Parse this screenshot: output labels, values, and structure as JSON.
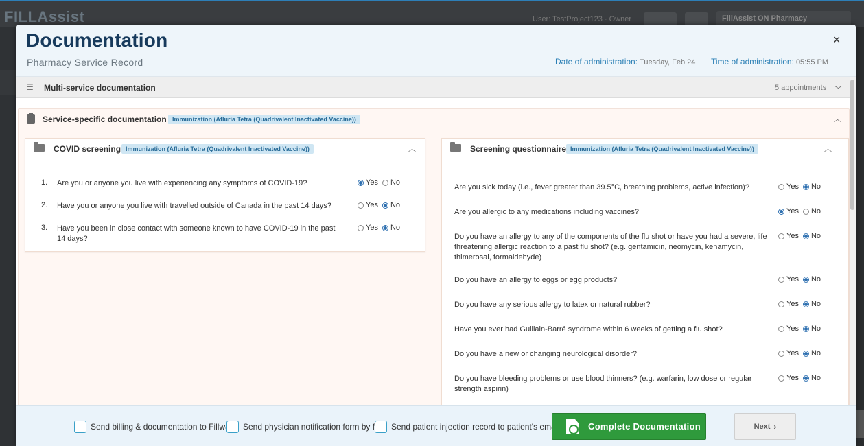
{
  "app": {
    "logo": "FILLAssist",
    "user_text": "User: TestProject123 · Owner",
    "pharmacy": "FillAssist ON Pharmacy"
  },
  "modal": {
    "title": "Documentation",
    "subtitle": "Pharmacy Service Record",
    "close_glyph": "×",
    "date_label": "Date of administration:",
    "date_value": "Tuesday, Feb 24",
    "time_label": "Time of administration:",
    "time_value": "05:55 PM"
  },
  "multi_service": {
    "label": "Multi-service documentation",
    "count": "5 appointments"
  },
  "service_specific": {
    "label": "Service-specific documentation",
    "badge": "Immunization (Afluria Tetra (Quadrivalent Inactivated Vaccine))"
  },
  "covid": {
    "title": "COVID screening",
    "badge": "Immunization (Afluria Tetra (Quadrivalent Inactivated Vaccine))",
    "yes_label": "Yes",
    "no_label": "No",
    "questions": [
      {
        "num": "1.",
        "text": "Are you or anyone you live with experiencing any symptoms of COVID-19?",
        "answer": "yes"
      },
      {
        "num": "2.",
        "text": "Have you or anyone you live with travelled outside of Canada in the past 14 days?",
        "answer": "no"
      },
      {
        "num": "3.",
        "text": "Have you been in close contact with someone known to have COVID-19 in the past 14 days?",
        "answer": "no"
      }
    ]
  },
  "screening": {
    "title": "Screening questionnaire",
    "badge": "Immunization (Afluria Tetra (Quadrivalent Inactivated Vaccine))",
    "yes_label": "Yes",
    "no_label": "No",
    "questions": [
      {
        "text": "Are you sick today (i.e., fever greater than 39.5°C, breathing problems, active infection)?",
        "answer": "no"
      },
      {
        "text": "Are you allergic to any medications including vaccines?",
        "answer": "yes"
      },
      {
        "text": "Do you have an allergy to any of the components of the flu shot or have you had a severe, life threatening allergic reaction to a past flu shot? (e.g. gentamicin, neomycin, kenamycin, thimerosal, formaldehyde)",
        "answer": "no"
      },
      {
        "text": "Do you have an allergy to eggs or egg products?",
        "answer": "no"
      },
      {
        "text": "Do you have any serious allergy to latex or natural rubber?",
        "answer": "no"
      },
      {
        "text": "Have you ever had Guillain-Barré syndrome within 6 weeks of getting a flu shot?",
        "answer": "no"
      },
      {
        "text": "Do you have a new or changing neurological disorder?",
        "answer": "no"
      },
      {
        "text": "Do you have bleeding problems or use blood thinners? (e.g. warfarin, low dose or regular strength aspirin)",
        "answer": "no"
      }
    ]
  },
  "footer": {
    "cb1": "Send billing & documentation to Fillware",
    "cb2": "Send physician notification form by fax",
    "cb3": "Send patient injection record to patient's email",
    "complete": "Complete Documentation",
    "next": "Next"
  }
}
